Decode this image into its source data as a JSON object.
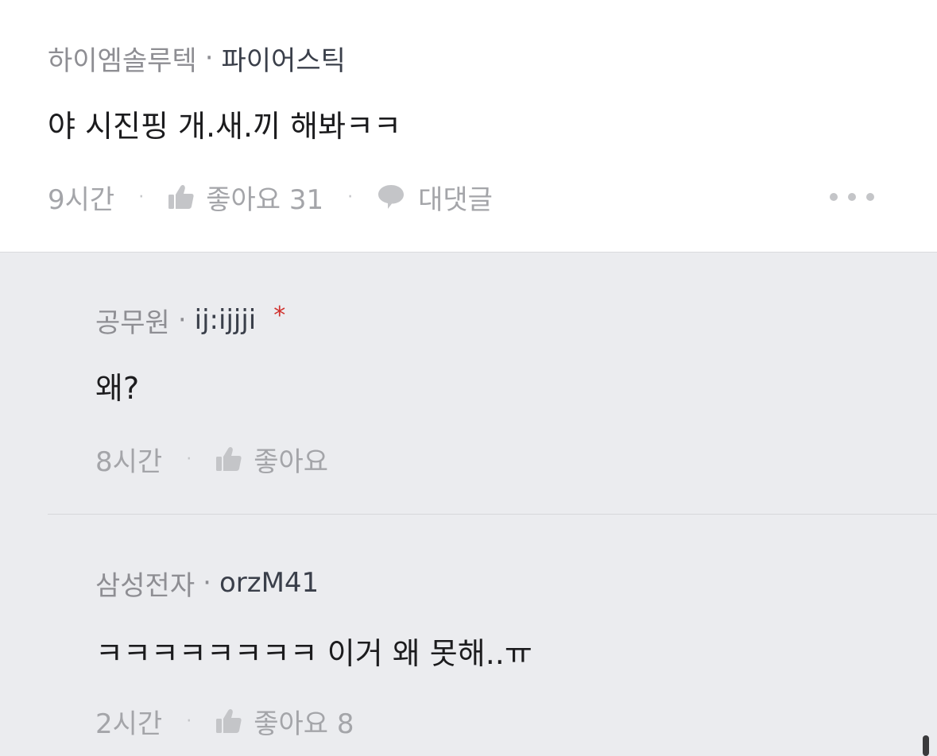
{
  "main_comment": {
    "company": "하이엠솔루텍",
    "separator": "·",
    "nickname": "파이어스틱",
    "body": "야 시진핑 개.새.끼 해봐ㅋㅋ",
    "time": "9시간",
    "like_label": "좋아요 31",
    "reply_label": "대댓글",
    "more_icon": "more-horizontal-icon"
  },
  "replies": [
    {
      "company": "공무원",
      "separator": "·",
      "nickname": "ij:ijjji",
      "author_mark": "*",
      "body": "왜?",
      "time": "8시간",
      "like_label": "좋아요"
    },
    {
      "company": "삼성전자",
      "separator": "·",
      "nickname": "orzM41",
      "body": "ㅋㅋㅋㅋㅋㅋㅋㅋ 이거 왜 못해..ㅠ",
      "time": "2시간",
      "like_label": "좋아요 8"
    }
  ],
  "colors": {
    "background": "#ebecef",
    "main_background": "#ffffff",
    "meta_gray": "#8e8e93",
    "action_gray": "#a4a5a9",
    "icon_gray": "#c4c5c8",
    "author_mark_red": "#d0312d"
  }
}
